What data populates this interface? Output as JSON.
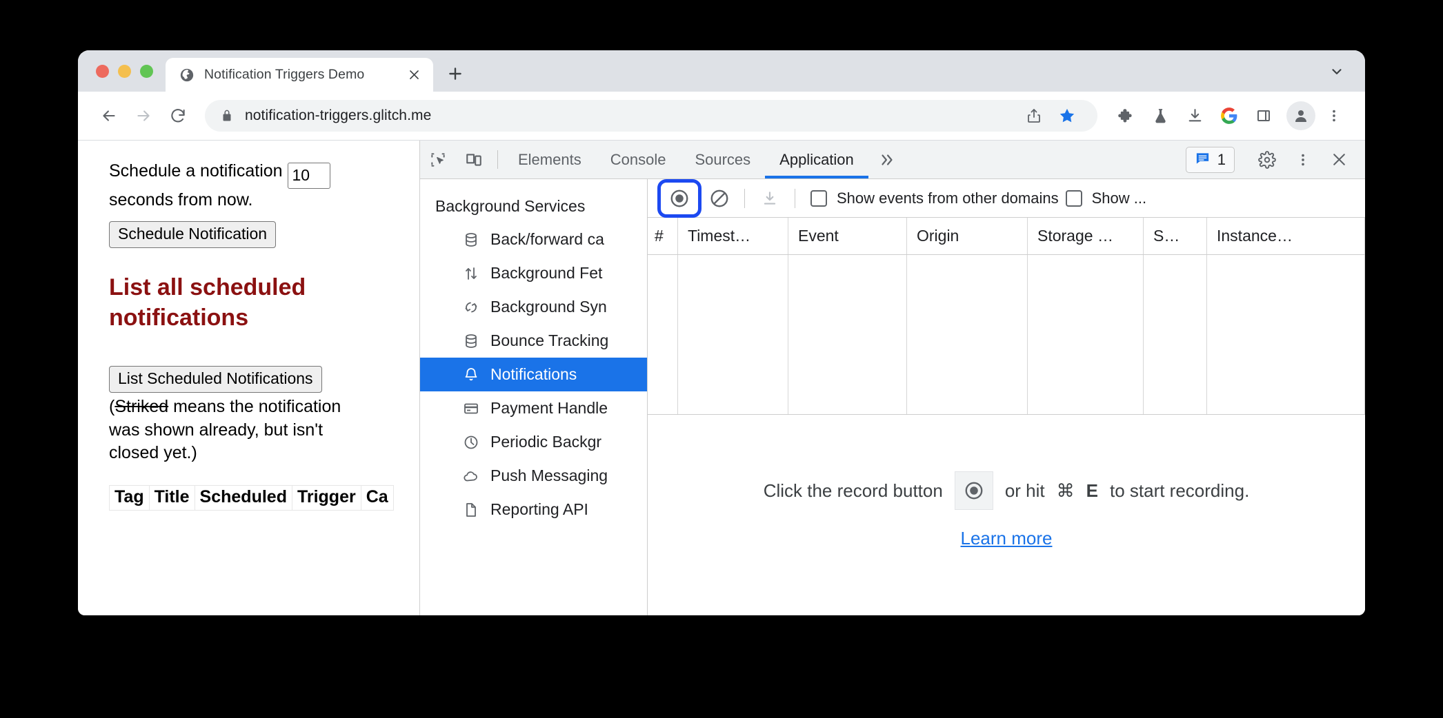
{
  "browser": {
    "tab": {
      "title": "Notification Triggers Demo",
      "favicon": "globe-icon",
      "close": "×"
    },
    "new_tab_label": "+",
    "tab_list_chevron": "chevron-down-icon",
    "omnibox": {
      "url": "notification-triggers.glitch.me",
      "lock": "lock-icon"
    },
    "nav": {
      "back": "arrow-left-icon",
      "forward": "arrow-right-icon",
      "reload": "reload-icon"
    },
    "toolbar_icons": [
      "share-icon",
      "bookmark-star-icon",
      "extensions-puzzle-icon",
      "labs-flask-icon",
      "downloads-icon",
      "google-g-icon",
      "side-panel-icon",
      "profile-avatar-icon",
      "browser-menu-icon"
    ],
    "colors": {
      "tab_strip": "#dee1e6",
      "accent_blue": "#1a73e8",
      "bookmark_star": "#1a73e8"
    }
  },
  "page": {
    "schedule_text_before": "Schedule a notification ",
    "seconds_value": "10",
    "schedule_text_after": " seconds from now.",
    "schedule_button": "Schedule Notification",
    "heading": "List all scheduled notifications",
    "heading_color": "#8b1111",
    "list_button": "List Scheduled Notifications",
    "note_open": "(",
    "note_striked": "Striked",
    "note_rest": " means the notification was shown already, but isn't closed yet.)",
    "table_headers": [
      "Tag",
      "Title",
      "Scheduled",
      "Trigger",
      "Ca"
    ]
  },
  "devtools": {
    "tools": {
      "inspect": "inspect-element-icon",
      "device": "device-toolbar-icon"
    },
    "tabs": [
      {
        "label": "Elements",
        "active": false
      },
      {
        "label": "Console",
        "active": false
      },
      {
        "label": "Sources",
        "active": false
      },
      {
        "label": "Application",
        "active": true
      }
    ],
    "overflow": "»",
    "issues": {
      "icon": "issues-message-icon",
      "count": "1"
    },
    "settings_icon": "gear-icon",
    "more_icon": "more-vertical-icon",
    "close_icon": "close-icon",
    "sidebar": {
      "heading": "Background Services",
      "items": [
        {
          "label": "Back/forward ca",
          "icon": "database-icon",
          "selected": false
        },
        {
          "label": "Background Fet",
          "icon": "arrows-updown-icon",
          "selected": false
        },
        {
          "label": "Background Syn",
          "icon": "sync-icon",
          "selected": false
        },
        {
          "label": "Bounce Tracking",
          "icon": "database-icon",
          "selected": false
        },
        {
          "label": "Notifications",
          "icon": "bell-icon",
          "selected": true
        },
        {
          "label": "Payment Handle",
          "icon": "credit-card-icon",
          "selected": false
        },
        {
          "label": "Periodic Backgr",
          "icon": "clock-icon",
          "selected": false
        },
        {
          "label": "Push Messaging",
          "icon": "cloud-icon",
          "selected": false
        },
        {
          "label": "Reporting API",
          "icon": "document-icon",
          "selected": false
        }
      ]
    },
    "toolbar": {
      "record_icon": "record-circle-icon",
      "record_highlighted": true,
      "highlight_color": "#1c49f1",
      "clear_icon": "clear-no-entry-icon",
      "export_icon": "download-icon",
      "checkbox_1": "Show events from other domains",
      "checkbox_2": "Show ..."
    },
    "events_table": {
      "columns": [
        "#",
        "Timest…",
        "Event",
        "Origin",
        "Storage …",
        "S…",
        "Instance…"
      ],
      "rows": []
    },
    "empty_state": {
      "text_before": "Click the record button",
      "record_icon": "record-circle-icon",
      "text_mid": "or hit",
      "kbd_cmd": "⌘",
      "kbd_key": "E",
      "text_after": "to start recording.",
      "learn_more": "Learn more"
    }
  }
}
